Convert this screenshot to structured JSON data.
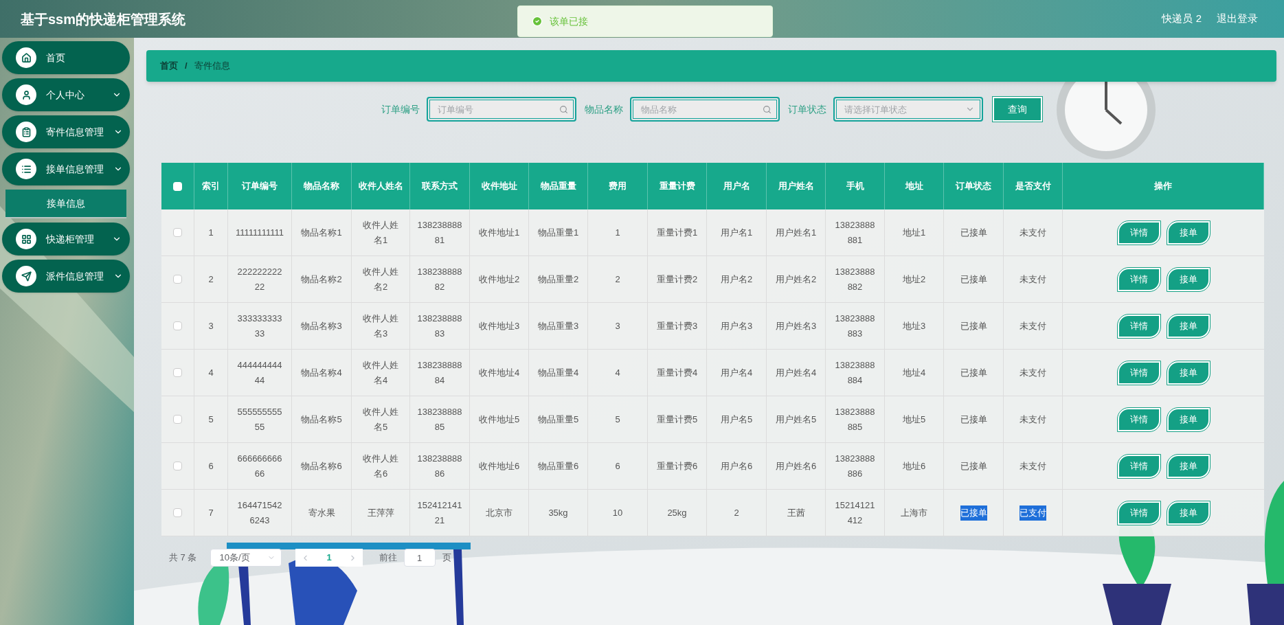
{
  "header": {
    "title": "基于ssm的快递柜管理系统",
    "user": "快递员 2",
    "logout": "退出登录"
  },
  "toast": {
    "message": "该单已接"
  },
  "sidebar": {
    "items": [
      {
        "label": "首页",
        "kind": "link",
        "selected": false
      },
      {
        "label": "个人中心",
        "kind": "menu",
        "selected": false
      },
      {
        "label": "寄件信息管理",
        "kind": "menu",
        "selected": false
      },
      {
        "label": "接单信息管理",
        "kind": "menu",
        "expanded": true,
        "selected": false,
        "children": [
          {
            "label": "接单信息",
            "selected": true
          }
        ]
      },
      {
        "label": "快递柜管理",
        "kind": "menu",
        "selected": false
      },
      {
        "label": "派件信息管理",
        "kind": "menu",
        "selected": false
      }
    ]
  },
  "breadcrumb": [
    "首页",
    "寄件信息"
  ],
  "breadcrumb_separator": "/",
  "search": {
    "fields": [
      {
        "label": "订单编号",
        "kind": "input",
        "placeholder": "订单编号"
      },
      {
        "label": "物品名称",
        "kind": "input",
        "placeholder": "物品名称"
      },
      {
        "label": "订单状态",
        "kind": "select",
        "placeholder": "请选择订单状态"
      }
    ],
    "button": "查询"
  },
  "table": {
    "select_all": {
      "checked": false
    },
    "columns": [
      "索引",
      "订单编号",
      "物品名称",
      "收件人姓名",
      "联系方式",
      "收件地址",
      "物品重量",
      "费用",
      "重量计费",
      "用户名",
      "用户姓名",
      "手机",
      "地址",
      "订单状态",
      "是否支付",
      "操作"
    ],
    "rows": [
      {
        "checked": false,
        "status_highlighted": false,
        "paid_highlighted": false,
        "cells": [
          "1",
          "11111111111",
          "物品名称1",
          "收件人姓名1",
          "13823888881",
          "收件地址1",
          "物品重量1",
          "1",
          "重量计费1",
          "用户名1",
          "用户姓名1",
          "13823888881",
          "地址1",
          "已接单",
          "未支付"
        ],
        "actions": [
          "详情",
          "接单"
        ]
      },
      {
        "checked": false,
        "status_highlighted": false,
        "paid_highlighted": false,
        "cells": [
          "2",
          "22222222222",
          "物品名称2",
          "收件人姓名2",
          "13823888882",
          "收件地址2",
          "物品重量2",
          "2",
          "重量计费2",
          "用户名2",
          "用户姓名2",
          "13823888882",
          "地址2",
          "已接单",
          "未支付"
        ],
        "actions": [
          "详情",
          "接单"
        ]
      },
      {
        "checked": false,
        "status_highlighted": false,
        "paid_highlighted": false,
        "cells": [
          "3",
          "33333333333",
          "物品名称3",
          "收件人姓名3",
          "13823888883",
          "收件地址3",
          "物品重量3",
          "3",
          "重量计费3",
          "用户名3",
          "用户姓名3",
          "13823888883",
          "地址3",
          "已接单",
          "未支付"
        ],
        "actions": [
          "详情",
          "接单"
        ]
      },
      {
        "checked": false,
        "status_highlighted": false,
        "paid_highlighted": false,
        "cells": [
          "4",
          "44444444444",
          "物品名称4",
          "收件人姓名4",
          "13823888884",
          "收件地址4",
          "物品重量4",
          "4",
          "重量计费4",
          "用户名4",
          "用户姓名4",
          "13823888884",
          "地址4",
          "已接单",
          "未支付"
        ],
        "actions": [
          "详情",
          "接单"
        ]
      },
      {
        "checked": false,
        "status_highlighted": false,
        "paid_highlighted": false,
        "cells": [
          "5",
          "55555555555",
          "物品名称5",
          "收件人姓名5",
          "13823888885",
          "收件地址5",
          "物品重量5",
          "5",
          "重量计费5",
          "用户名5",
          "用户姓名5",
          "13823888885",
          "地址5",
          "已接单",
          "未支付"
        ],
        "actions": [
          "详情",
          "接单"
        ]
      },
      {
        "checked": false,
        "status_highlighted": false,
        "paid_highlighted": false,
        "cells": [
          "6",
          "66666666666",
          "物品名称6",
          "收件人姓名6",
          "13823888886",
          "收件地址6",
          "物品重量6",
          "6",
          "重量计费6",
          "用户名6",
          "用户姓名6",
          "13823888886",
          "地址6",
          "已接单",
          "未支付"
        ],
        "actions": [
          "详情",
          "接单"
        ]
      },
      {
        "checked": false,
        "status_highlighted": true,
        "paid_highlighted": true,
        "cells": [
          "7",
          "1644715426243",
          "寄水果",
          "王萍萍",
          "15241214121",
          "北京市",
          "35kg",
          "10",
          "25kg",
          "2",
          "王茜",
          "15214121412",
          "上海市",
          "已接单",
          "已支付"
        ],
        "actions": [
          "详情",
          "接单"
        ]
      }
    ]
  },
  "pagination": {
    "total": "共 7 条",
    "page_size": "10条/页",
    "pages": [
      {
        "label": "1",
        "selected": true
      }
    ],
    "goto_label": "前往",
    "goto_value": "1",
    "goto_suffix": "页"
  }
}
